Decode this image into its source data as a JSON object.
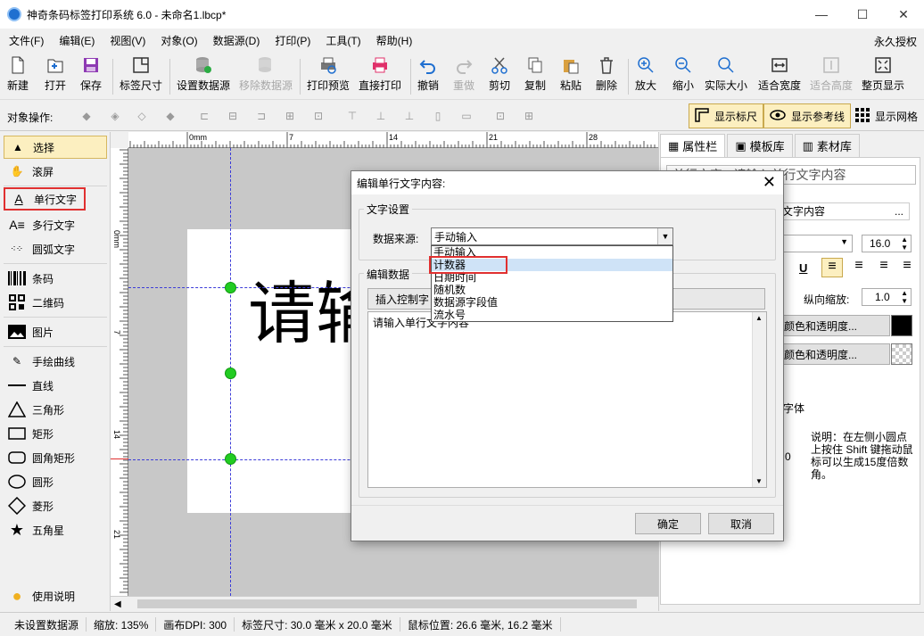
{
  "window": {
    "title": "神奇条码标签打印系统 6.0 - 未命名1.lbcp*",
    "minimize": "—",
    "maximize": "☐",
    "close": "✕"
  },
  "menu": {
    "items": [
      "文件(F)",
      "编辑(E)",
      "视图(V)",
      "对象(O)",
      "数据源(D)",
      "打印(P)",
      "工具(T)",
      "帮助(H)"
    ],
    "license": "永久授权"
  },
  "toolbar": {
    "new": "新建",
    "open": "打开",
    "save": "保存",
    "label_size": "标签尺寸",
    "set_datasource": "设置数据源",
    "remove_datasource": "移除数据源",
    "print_preview": "打印预览",
    "direct_print": "直接打印",
    "undo": "撤销",
    "redo": "重做",
    "cut": "剪切",
    "copy": "复制",
    "paste": "粘贴",
    "delete": "删除",
    "zoom_in": "放大",
    "zoom_out": "缩小",
    "actual_size": "实际大小",
    "fit_width": "适合宽度",
    "fit_height": "适合高度",
    "full_page": "整页显示"
  },
  "objbar": {
    "label": "对象操作:",
    "show_ruler": "显示标尺",
    "show_guides": "显示参考线",
    "show_grid": "显示网格"
  },
  "sidebar": {
    "items": [
      "选择",
      "滚屏",
      "单行文字",
      "多行文字",
      "圆弧文字",
      "条码",
      "二维码",
      "图片",
      "手绘曲线",
      "直线",
      "三角形",
      "矩形",
      "圆角矩形",
      "圆形",
      "菱形",
      "五角星"
    ],
    "help": "使用说明"
  },
  "ruler": {
    "h_ticks": [
      "0mm",
      "7",
      "14",
      "21",
      "28"
    ],
    "v_ticks": [
      "0mm",
      "7",
      "14",
      "21"
    ]
  },
  "canvas": {
    "preview_text": "请输"
  },
  "right_panel": {
    "tabs": [
      "属性栏",
      "模板库",
      "素材库"
    ],
    "object_select": "单行文字 - 请输入单行文字内容",
    "content_field": "文字内容",
    "font_size": "16.0",
    "v_scale_label": "纵向缩放:",
    "v_scale_value": "1.0",
    "color_button": "颜色和透明度...",
    "bg_button": "颜色和透明度...",
    "font_label": "字体",
    "zero": "0",
    "note": "说明：在左侧小圆点上按住 Shift 键拖动鼠标可以生成15度倍数角。",
    "ellipsis": "...",
    "underline": "U"
  },
  "dialog": {
    "title": "编辑单行文字内容:",
    "group_text": "文字设置",
    "source_label": "数据来源:",
    "source_value": "手动输入",
    "options": [
      "手动输入",
      "计数器",
      "日期时间",
      "随机数",
      "数据源字段值",
      "流水号"
    ],
    "group_edit": "编辑数据",
    "insert_control": "插入控制字",
    "content": "请输入单行文字内容",
    "ok": "确定",
    "cancel": "取消"
  },
  "status": {
    "datasource": "未设置数据源",
    "zoom": "缩放: 135%",
    "dpi": "画布DPI: 300",
    "label_size": "标签尺寸: 30.0 毫米 x 20.0 毫米",
    "mouse_pos": "鼠标位置: 26.6 毫米, 16.2 毫米"
  },
  "colors": {
    "accent": "#1f6fd0",
    "highlight": "#e03030",
    "toggle_on": "#fcefc0",
    "handle": "#22cc22"
  }
}
